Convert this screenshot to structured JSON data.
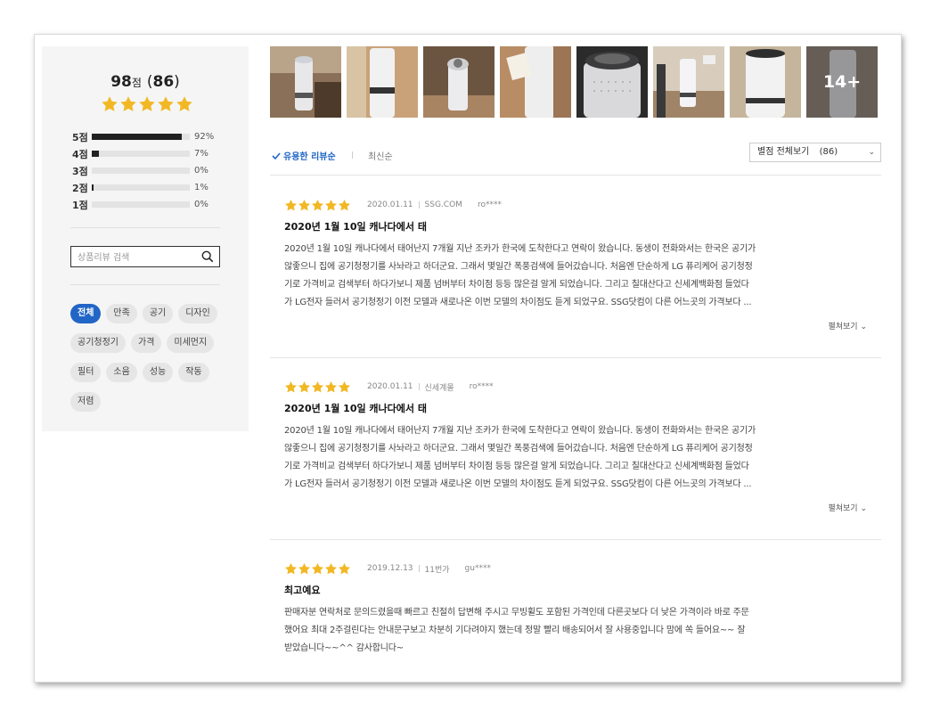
{
  "summary": {
    "score": "98",
    "score_unit": "점",
    "count": "86",
    "distribution": [
      {
        "label": "5점",
        "pct_text": "92%",
        "fraction": 0.92
      },
      {
        "label": "4점",
        "pct_text": "7%",
        "fraction": 0.07
      },
      {
        "label": "3점",
        "pct_text": "0%",
        "fraction": 0.0
      },
      {
        "label": "2점",
        "pct_text": "1%",
        "fraction": 0.01
      },
      {
        "label": "1점",
        "pct_text": "0%",
        "fraction": 0.0
      }
    ]
  },
  "search": {
    "placeholder": "상품리뷰 검색",
    "icon": "search-icon"
  },
  "tags": [
    "전체",
    "만족",
    "공기",
    "디자인",
    "공기청정기",
    "가격",
    "미세먼지",
    "필터",
    "소음",
    "성능",
    "작동",
    "저렴"
  ],
  "active_tag": "전체",
  "thumbnails": {
    "more_label": "14+"
  },
  "sort": {
    "helpful_label": "유용한 리뷰순",
    "latest_label": "최신순",
    "filter_label": "별점 전체보기",
    "filter_count": "(86)"
  },
  "reviews": [
    {
      "date": "2020.01.11",
      "source": "SSG.COM",
      "user": "ro****",
      "title": "2020년 1월 10일 캐나다에서 태",
      "lines": [
        "2020년 1월 10일 캐나다에서 태어난지 7개월 지난 조카가 한국에 도착한다고 연락이 왔습니다. 동생이 전화와서는 한국은 공기가",
        "않좋으니 집에 공기청정기를 사놔라고 하더군요. 그래서 몇일간 폭풍검색에 들어갔습니다. 처음엔 단순하게 LG 퓨리케어 공기청정",
        "기로 가격비교 검색부터 하다가보니 제품 넘버부터 차이점 등등 많은걸 알게 되었습니다. 그리고 칠대산다고 신세계백화점 들었다",
        "가 LG전자 들러서 공기청정기 이전 모델과 새로나온 이번 모델의 차이점도 듣게 되었구요. SSG닷컴이 다른 어느곳의 가격보다 ..."
      ],
      "more": "펼쳐보기"
    },
    {
      "date": "2020.01.11",
      "source": "신세계몰",
      "user": "ro****",
      "title": "2020년 1월 10일 캐나다에서 태",
      "lines": [
        "2020년 1월 10일 캐나다에서 태어난지 7개월 지난 조카가 한국에 도착한다고 연락이 왔습니다. 동생이 전화와서는 한국은 공기가",
        "않좋으니 집에 공기청정기를 사놔라고 하더군요. 그래서 몇일간 폭풍검색에 들어갔습니다. 처음엔 단순하게 LG 퓨리케어 공기청정",
        "기로 가격비교 검색부터 하다가보니 제품 넘버부터 차이점 등등 많은걸 알게 되었습니다. 그리고 칠대산다고 신세계백화점 들었다",
        "가 LG전자 들러서 공기청정기 이전 모델과 새로나온 이번 모델의 차이점도 듣게 되었구요. SSG닷컴이 다른 어느곳의 가격보다 ..."
      ],
      "more": "펼쳐보기"
    },
    {
      "date": "2019.12.13",
      "source": "11번가",
      "user": "gu****",
      "title": "최고예요",
      "lines": [
        "판매자분 연락처로 문의드렸을때 빠르고 친절히 답변해 주시고 무빙휠도 포함된 가격인데 다른곳보다 더 낮은 가격이라 바로 주문",
        "했어요 최대 2주걸린다는 안내문구보고 차분히 기다려야지 했는데 정말 빨리 배송되어서 잘 사용중입니다 맘에 쏙 들어요~~ 잘",
        "받았습니다~~^^ 감사합니다~"
      ],
      "more": ""
    }
  ],
  "colors": {
    "accent": "#2166c6",
    "star": "#f2b824"
  }
}
